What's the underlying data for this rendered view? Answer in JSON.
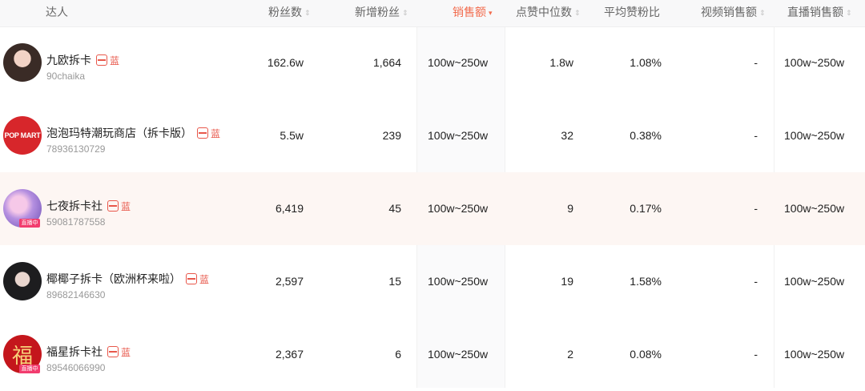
{
  "header": {
    "influencer": "达人",
    "fans": "粉丝数",
    "new_fans": "新增粉丝",
    "sales": "销售额",
    "like_median": "点赞中位数",
    "avg_like_ratio": "平均赞粉比",
    "video_sales": "视频销售额",
    "live_sales": "直播销售额"
  },
  "sort_icons": {
    "neutral": "⇕",
    "active_down": "▾"
  },
  "badge_text": "蓝",
  "rows": [
    {
      "name": "九欧拆卡",
      "uid": "90chaika",
      "fans": "162.6w",
      "new_fans": "1,664",
      "sales": "100w~250w",
      "like_median": "1.8w",
      "avg_like_ratio": "1.08%",
      "video_sales": "-",
      "live_sales": "100w~250w",
      "live": ""
    },
    {
      "name": "泡泡玛特潮玩商店（拆卡版）",
      "uid": "78936130729",
      "fans": "5.5w",
      "new_fans": "239",
      "sales": "100w~250w",
      "like_median": "32",
      "avg_like_ratio": "0.38%",
      "video_sales": "-",
      "live_sales": "100w~250w",
      "live": "",
      "logo": "POP MART"
    },
    {
      "name": "七夜拆卡社",
      "uid": "59081787558",
      "fans": "6,419",
      "new_fans": "45",
      "sales": "100w~250w",
      "like_median": "9",
      "avg_like_ratio": "0.17%",
      "video_sales": "-",
      "live_sales": "100w~250w",
      "live": "直播中"
    },
    {
      "name": "椰椰子拆卡（欧洲杯来啦）",
      "uid": "89682146630",
      "fans": "2,597",
      "new_fans": "15",
      "sales": "100w~250w",
      "like_median": "19",
      "avg_like_ratio": "1.58%",
      "video_sales": "-",
      "live_sales": "100w~250w",
      "live": ""
    },
    {
      "name": "福星拆卡社",
      "uid": "89546066990",
      "fans": "2,367",
      "new_fans": "6",
      "sales": "100w~250w",
      "like_median": "2",
      "avg_like_ratio": "0.08%",
      "video_sales": "-",
      "live_sales": "100w~250w",
      "live": "直播中",
      "logo": "福"
    }
  ],
  "colors": {
    "accent": "#f26b4d",
    "badge": "#e8574a",
    "live": "#f23c6e",
    "highlight_row": "#fdf6f3"
  }
}
